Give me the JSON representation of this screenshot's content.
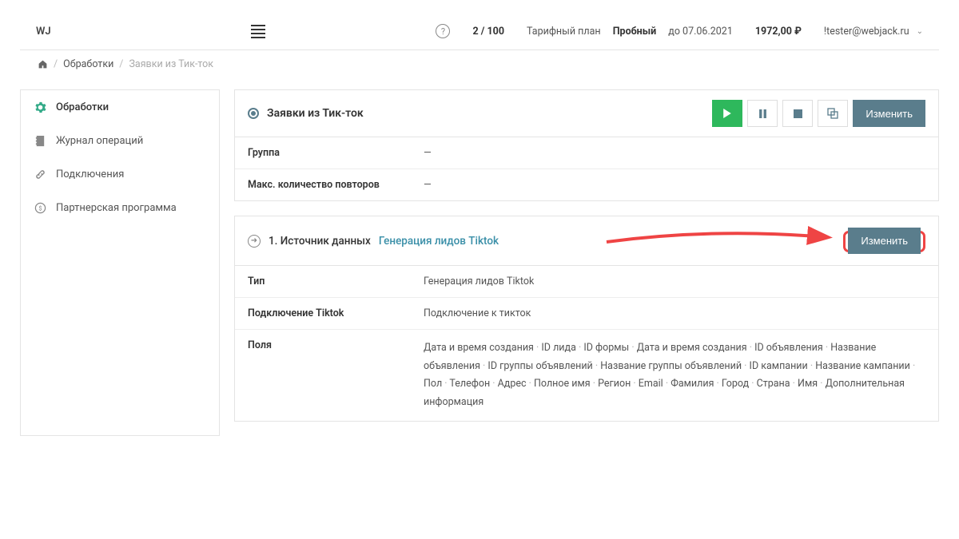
{
  "header": {
    "logo": "WJ",
    "usage": "2 / 100",
    "plan_prefix": "Тарифный план",
    "plan_name": "Пробный",
    "plan_until": "до 07.06.2021",
    "balance": "1972,00 ₽",
    "user": "!tester@webjack.ru"
  },
  "breadcrumbs": {
    "l1": "Обработки",
    "l2": "Заявки из Тик-ток"
  },
  "sidebar": {
    "items": [
      {
        "label": "Обработки"
      },
      {
        "label": "Журнал операций"
      },
      {
        "label": "Подключения"
      },
      {
        "label": "Партнерская программа"
      }
    ]
  },
  "process": {
    "title": "Заявки из Тик-ток",
    "edit_btn": "Изменить",
    "props": [
      {
        "label": "Группа",
        "value": "—"
      },
      {
        "label": "Макс. количество повторов",
        "value": "—"
      }
    ]
  },
  "source": {
    "step_label": "1. Источник данных",
    "name": "Генерация лидов Tiktok",
    "edit_btn": "Изменить",
    "rows": {
      "type_label": "Тип",
      "type_value": "Генерация лидов Tiktok",
      "conn_label": "Подключение Tiktok",
      "conn_value": "Подключение к тикток",
      "fields_label": "Поля",
      "fields": [
        "Дата и время создания",
        "ID лида",
        "ID формы",
        "Дата и время создания",
        "ID объявления",
        "Название объявления",
        "ID группы объявлений",
        "Название группы объявлений",
        "ID кампании",
        "Название кампании",
        "Пол",
        "Телефон",
        "Адрес",
        "Полное имя",
        "Регион",
        "Email",
        "Фамилия",
        "Город",
        "Страна",
        "Имя",
        "Дополнительная информация"
      ]
    }
  }
}
